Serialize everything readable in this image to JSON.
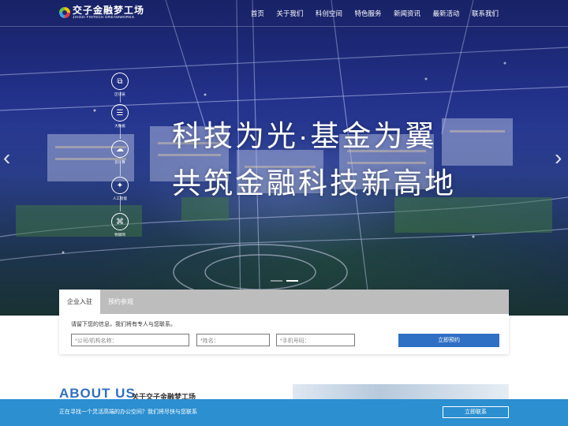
{
  "header": {
    "logo_cn": "交子金融梦工场",
    "logo_en": "JIAOZI FINTECH DREAMWORKS",
    "nav": [
      "首页",
      "关于我们",
      "科创空间",
      "特色服务",
      "新闻资讯",
      "最新活动",
      "联系我们"
    ]
  },
  "hero": {
    "headline_1": "科技为光·基金为翼",
    "headline_2": "共筑金融科技新高地",
    "features": [
      "区块链",
      "大数据",
      "云计算",
      "人工智能",
      "物联网"
    ],
    "prev_arrow": "‹",
    "next_arrow": "›"
  },
  "form": {
    "tabs": [
      "企业入驻",
      "预约参观"
    ],
    "hint": "请留下您的信息，我们将有专人与您联系。",
    "company_placeholder": "*公司/机构名称：",
    "name_placeholder": "*姓名：",
    "phone_placeholder": "*手机号码：",
    "submit": "立即预约"
  },
  "about": {
    "title_en": "ABOUT US",
    "title_cn": "关于交子金融梦工场"
  },
  "bottom_bar": {
    "text": "正在寻找一个灵活高端的办公空间？我们将尽快与您联系",
    "button": "立即联系"
  },
  "colors": {
    "accent": "#2f6fc4",
    "bottom_bar": "#2b8fd0",
    "tab_inactive": "#bdbdbd"
  }
}
